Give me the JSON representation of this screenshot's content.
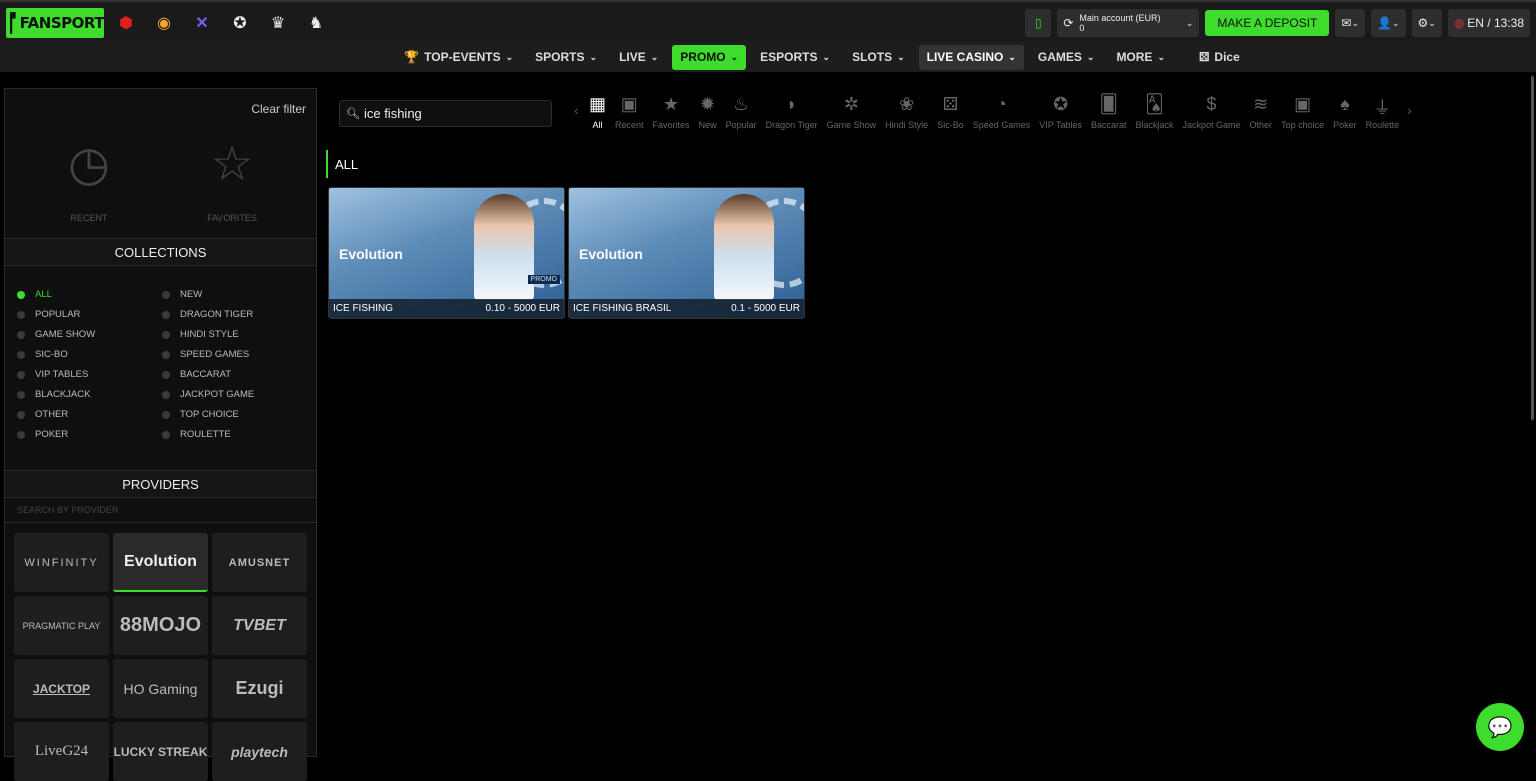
{
  "brand": {
    "name": "FANSPORT"
  },
  "header": {
    "account_label": "Main account (EUR)",
    "account_balance": "0",
    "deposit_label": "MAKE A DEPOSIT",
    "lang_time": "EN / 13:38"
  },
  "nav": [
    "TOP-EVENTS",
    "SPORTS",
    "LIVE",
    "PROMO",
    "ESPORTS",
    "SLOTS",
    "LIVE CASINO",
    "GAMES",
    "MORE"
  ],
  "nav_extra": "Dice",
  "sidebar": {
    "clear_filter": "Clear filter",
    "recent": "RECENT",
    "favorites": "FAVORITES",
    "collections_title": "COLLECTIONS",
    "collections": [
      "ALL",
      "NEW",
      "POPULAR",
      "DRAGON TIGER",
      "GAME SHOW",
      "HINDI STYLE",
      "SIC-BO",
      "SPEED GAMES",
      "VIP TABLES",
      "BACCARAT",
      "BLACKJACK",
      "JACKPOT GAME",
      "OTHER",
      "TOP CHOICE",
      "POKER",
      "ROULETTE"
    ],
    "providers_title": "PROVIDERS",
    "provider_search_placeholder": "SEARCH BY PROVIDER",
    "providers": [
      "WINFINITY",
      "Evolution",
      "AMUSNET",
      "PRAGMATIC PLAY",
      "88MOJO",
      "TVBET",
      "JACKTOP",
      "HO Gaming",
      "Ezugi",
      "LiveG24",
      "LUCKY STREAK",
      "playtech"
    ]
  },
  "search": {
    "value": "ice fishing"
  },
  "categories": [
    "All",
    "Recent",
    "Favorites",
    "New",
    "Popular",
    "Dragon Tiger",
    "Game Show",
    "Hindi Style",
    "Sic-Bo",
    "Speed Games",
    "VIP Tables",
    "Baccarat",
    "Blackjack",
    "Jackpot Game",
    "Other",
    "Top choice",
    "Poker",
    "Roulette"
  ],
  "section_title": "ALL",
  "games": [
    {
      "name": "ICE FISHING",
      "range": "0.10 - 5000 EUR",
      "provider": "Evolution",
      "badge": "PROMO"
    },
    {
      "name": "ICE FISHING BRASIL",
      "range": "0.1 - 5000 EUR",
      "provider": "Evolution"
    }
  ],
  "colors": {
    "accent": "#3ddc2d",
    "bg": "#000000"
  }
}
